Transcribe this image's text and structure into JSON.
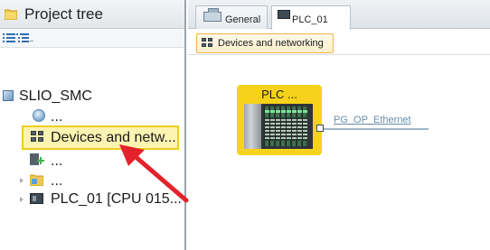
{
  "tree": {
    "title": "Project tree",
    "items": [
      {
        "label": "SLIO_SMC",
        "icon": "project-icon"
      },
      {
        "label": "...",
        "icon": "info-globe-icon"
      },
      {
        "label": "Devices and netw...",
        "icon": "devices-networks-icon",
        "selected": true
      },
      {
        "label": "...",
        "icon": "add-device-icon"
      },
      {
        "label": "...",
        "icon": "folder-icon"
      },
      {
        "label": "PLC_01 [CPU 015...",
        "icon": "plc-icon"
      }
    ]
  },
  "editor": {
    "tabs": [
      {
        "label": "General",
        "icon": "general-icon"
      },
      {
        "label": "PLC_01",
        "icon": "plc-icon",
        "active": true
      }
    ],
    "subtab": {
      "label": "Devices and networking",
      "icon": "devices-networks-icon"
    },
    "device": {
      "label": "PLC ...",
      "network_label": "PG_OP_Ethernet"
    }
  },
  "colors": {
    "selection_fill": "#fdf4b2",
    "selection_border": "#f0cc1c",
    "device_yellow": "#f6d31a",
    "annotation_arrow": "#e3222b"
  }
}
